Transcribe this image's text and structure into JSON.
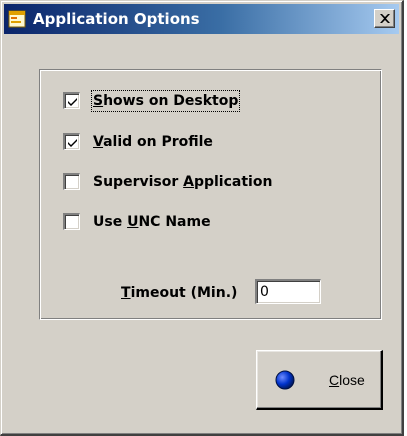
{
  "window": {
    "title": "Application Options",
    "title_icon": "app-window-icon",
    "close_icon": "close-x-icon"
  },
  "options": [
    {
      "label": "Shows on Desktop",
      "accel": "S",
      "checked": true,
      "focused": true
    },
    {
      "label": "Valid on Profile",
      "accel": "V",
      "checked": true,
      "focused": false
    },
    {
      "label": "Supervisor Application",
      "accel": "A",
      "checked": false,
      "focused": false
    },
    {
      "label": "Use UNC Name",
      "accel": "U",
      "checked": false,
      "focused": false
    }
  ],
  "timeout": {
    "label": "Timeout (Min.)",
    "accel": "T",
    "value": "0"
  },
  "close_button": {
    "label": "Close",
    "accel": "C",
    "icon": "blue-dot-icon"
  },
  "colors": {
    "dialog_face": "#d4d0c8",
    "title_start": "#0a246a",
    "title_end": "#a6caf0",
    "button_dot": "#0033cc"
  }
}
